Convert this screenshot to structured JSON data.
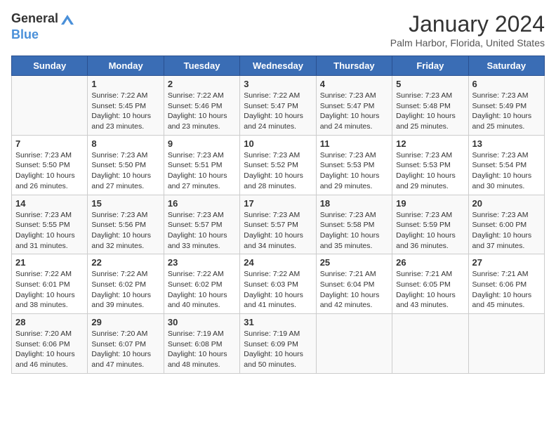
{
  "header": {
    "logo_general": "General",
    "logo_blue": "Blue",
    "title": "January 2024",
    "subtitle": "Palm Harbor, Florida, United States"
  },
  "days_of_week": [
    "Sunday",
    "Monday",
    "Tuesday",
    "Wednesday",
    "Thursday",
    "Friday",
    "Saturday"
  ],
  "weeks": [
    [
      {
        "day": "",
        "empty": true
      },
      {
        "day": "1",
        "sunrise": "Sunrise: 7:22 AM",
        "sunset": "Sunset: 5:45 PM",
        "daylight": "Daylight: 10 hours and 23 minutes."
      },
      {
        "day": "2",
        "sunrise": "Sunrise: 7:22 AM",
        "sunset": "Sunset: 5:46 PM",
        "daylight": "Daylight: 10 hours and 23 minutes."
      },
      {
        "day": "3",
        "sunrise": "Sunrise: 7:22 AM",
        "sunset": "Sunset: 5:47 PM",
        "daylight": "Daylight: 10 hours and 24 minutes."
      },
      {
        "day": "4",
        "sunrise": "Sunrise: 7:23 AM",
        "sunset": "Sunset: 5:47 PM",
        "daylight": "Daylight: 10 hours and 24 minutes."
      },
      {
        "day": "5",
        "sunrise": "Sunrise: 7:23 AM",
        "sunset": "Sunset: 5:48 PM",
        "daylight": "Daylight: 10 hours and 25 minutes."
      },
      {
        "day": "6",
        "sunrise": "Sunrise: 7:23 AM",
        "sunset": "Sunset: 5:49 PM",
        "daylight": "Daylight: 10 hours and 25 minutes."
      }
    ],
    [
      {
        "day": "7",
        "sunrise": "Sunrise: 7:23 AM",
        "sunset": "Sunset: 5:50 PM",
        "daylight": "Daylight: 10 hours and 26 minutes."
      },
      {
        "day": "8",
        "sunrise": "Sunrise: 7:23 AM",
        "sunset": "Sunset: 5:50 PM",
        "daylight": "Daylight: 10 hours and 27 minutes."
      },
      {
        "day": "9",
        "sunrise": "Sunrise: 7:23 AM",
        "sunset": "Sunset: 5:51 PM",
        "daylight": "Daylight: 10 hours and 27 minutes."
      },
      {
        "day": "10",
        "sunrise": "Sunrise: 7:23 AM",
        "sunset": "Sunset: 5:52 PM",
        "daylight": "Daylight: 10 hours and 28 minutes."
      },
      {
        "day": "11",
        "sunrise": "Sunrise: 7:23 AM",
        "sunset": "Sunset: 5:53 PM",
        "daylight": "Daylight: 10 hours and 29 minutes."
      },
      {
        "day": "12",
        "sunrise": "Sunrise: 7:23 AM",
        "sunset": "Sunset: 5:53 PM",
        "daylight": "Daylight: 10 hours and 29 minutes."
      },
      {
        "day": "13",
        "sunrise": "Sunrise: 7:23 AM",
        "sunset": "Sunset: 5:54 PM",
        "daylight": "Daylight: 10 hours and 30 minutes."
      }
    ],
    [
      {
        "day": "14",
        "sunrise": "Sunrise: 7:23 AM",
        "sunset": "Sunset: 5:55 PM",
        "daylight": "Daylight: 10 hours and 31 minutes."
      },
      {
        "day": "15",
        "sunrise": "Sunrise: 7:23 AM",
        "sunset": "Sunset: 5:56 PM",
        "daylight": "Daylight: 10 hours and 32 minutes."
      },
      {
        "day": "16",
        "sunrise": "Sunrise: 7:23 AM",
        "sunset": "Sunset: 5:57 PM",
        "daylight": "Daylight: 10 hours and 33 minutes."
      },
      {
        "day": "17",
        "sunrise": "Sunrise: 7:23 AM",
        "sunset": "Sunset: 5:57 PM",
        "daylight": "Daylight: 10 hours and 34 minutes."
      },
      {
        "day": "18",
        "sunrise": "Sunrise: 7:23 AM",
        "sunset": "Sunset: 5:58 PM",
        "daylight": "Daylight: 10 hours and 35 minutes."
      },
      {
        "day": "19",
        "sunrise": "Sunrise: 7:23 AM",
        "sunset": "Sunset: 5:59 PM",
        "daylight": "Daylight: 10 hours and 36 minutes."
      },
      {
        "day": "20",
        "sunrise": "Sunrise: 7:23 AM",
        "sunset": "Sunset: 6:00 PM",
        "daylight": "Daylight: 10 hours and 37 minutes."
      }
    ],
    [
      {
        "day": "21",
        "sunrise": "Sunrise: 7:22 AM",
        "sunset": "Sunset: 6:01 PM",
        "daylight": "Daylight: 10 hours and 38 minutes."
      },
      {
        "day": "22",
        "sunrise": "Sunrise: 7:22 AM",
        "sunset": "Sunset: 6:02 PM",
        "daylight": "Daylight: 10 hours and 39 minutes."
      },
      {
        "day": "23",
        "sunrise": "Sunrise: 7:22 AM",
        "sunset": "Sunset: 6:02 PM",
        "daylight": "Daylight: 10 hours and 40 minutes."
      },
      {
        "day": "24",
        "sunrise": "Sunrise: 7:22 AM",
        "sunset": "Sunset: 6:03 PM",
        "daylight": "Daylight: 10 hours and 41 minutes."
      },
      {
        "day": "25",
        "sunrise": "Sunrise: 7:21 AM",
        "sunset": "Sunset: 6:04 PM",
        "daylight": "Daylight: 10 hours and 42 minutes."
      },
      {
        "day": "26",
        "sunrise": "Sunrise: 7:21 AM",
        "sunset": "Sunset: 6:05 PM",
        "daylight": "Daylight: 10 hours and 43 minutes."
      },
      {
        "day": "27",
        "sunrise": "Sunrise: 7:21 AM",
        "sunset": "Sunset: 6:06 PM",
        "daylight": "Daylight: 10 hours and 45 minutes."
      }
    ],
    [
      {
        "day": "28",
        "sunrise": "Sunrise: 7:20 AM",
        "sunset": "Sunset: 6:06 PM",
        "daylight": "Daylight: 10 hours and 46 minutes."
      },
      {
        "day": "29",
        "sunrise": "Sunrise: 7:20 AM",
        "sunset": "Sunset: 6:07 PM",
        "daylight": "Daylight: 10 hours and 47 minutes."
      },
      {
        "day": "30",
        "sunrise": "Sunrise: 7:19 AM",
        "sunset": "Sunset: 6:08 PM",
        "daylight": "Daylight: 10 hours and 48 minutes."
      },
      {
        "day": "31",
        "sunrise": "Sunrise: 7:19 AM",
        "sunset": "Sunset: 6:09 PM",
        "daylight": "Daylight: 10 hours and 50 minutes."
      },
      {
        "day": "",
        "empty": true
      },
      {
        "day": "",
        "empty": true
      },
      {
        "day": "",
        "empty": true
      }
    ]
  ]
}
